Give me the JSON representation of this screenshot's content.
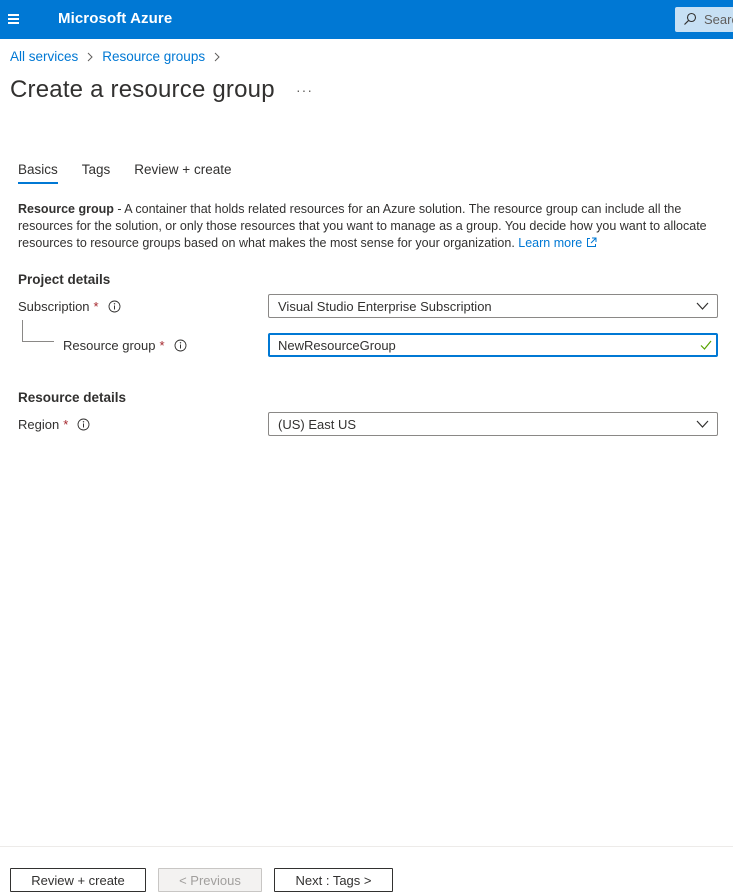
{
  "topbar": {
    "brand": "Microsoft Azure",
    "search_placeholder": "Search",
    "accent_color": "#0078d4"
  },
  "breadcrumb": {
    "items": [
      "All services",
      "Resource groups"
    ]
  },
  "page": {
    "title": "Create a resource group",
    "more": "···"
  },
  "tabs": [
    {
      "label": "Basics",
      "active": true
    },
    {
      "label": "Tags",
      "active": false
    },
    {
      "label": "Review + create",
      "active": false
    }
  ],
  "description": {
    "term": "Resource group",
    "text": " - A container that holds related resources for an Azure solution. The resource group can include all the resources for the solution, or only those resources that you want to manage as a group. You decide how you want to allocate resources to resource groups based on what makes the most sense for your organization. ",
    "link": "Learn more"
  },
  "project_details": {
    "title": "Project details",
    "subscription_label": "Subscription",
    "subscription_value": "Visual Studio Enterprise Subscription",
    "resource_group_label": "Resource group",
    "resource_group_value": "NewResourceGroup",
    "required_mark": "*"
  },
  "resource_details": {
    "title": "Resource details",
    "region_label": "Region",
    "region_value": "(US) East US",
    "required_mark": "*"
  },
  "footer": {
    "review_create": "Review + create",
    "previous": "< Previous",
    "next": "Next : Tags >"
  },
  "icons": {
    "menu": "hamburger-icon",
    "search": "search-icon",
    "info": "info-icon",
    "chevron": "chevron-down-icon",
    "check": "checkmark-icon",
    "external": "external-link-icon"
  }
}
